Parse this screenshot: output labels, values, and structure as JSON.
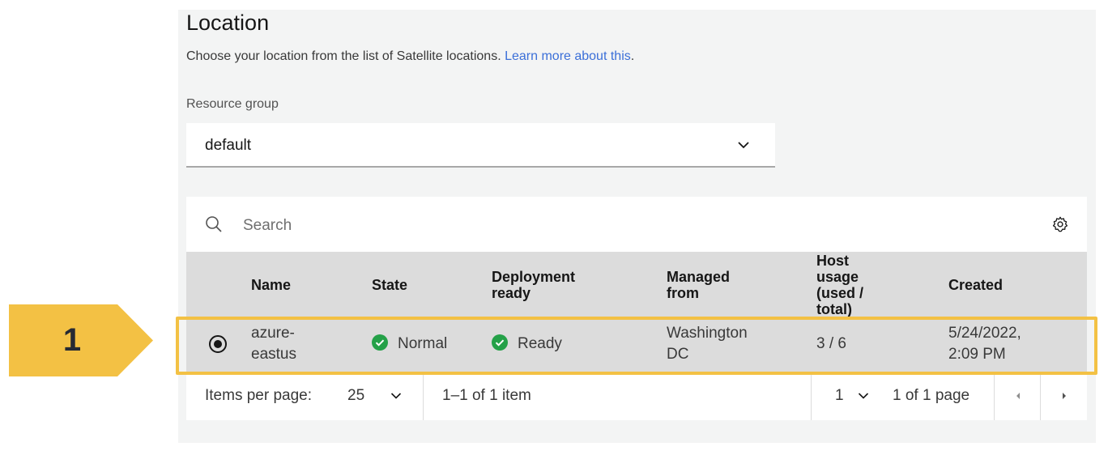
{
  "location": {
    "title": "Location",
    "description": "Choose your location from the list of Satellite locations.",
    "learn_more": "Learn more about this",
    "learn_more_suffix": "."
  },
  "resource_group": {
    "label": "Resource group",
    "selected": "default",
    "chevron_icon": "chevron-down-icon"
  },
  "table": {
    "search_placeholder": "Search",
    "settings_icon": "gear-icon",
    "columns": {
      "name": "Name",
      "state": "State",
      "deployment_line1": "Deployment",
      "deployment_line2": "ready",
      "managed_line1": "Managed",
      "managed_line2": "from",
      "host_line1": "Host",
      "host_line2": "usage",
      "host_line3": "(used /",
      "host_line4": "total)",
      "created": "Created"
    },
    "rows": [
      {
        "selected": true,
        "name_line1": "azure-",
        "name_line2": "eastus",
        "state": "Normal",
        "deployment_ready": "Ready",
        "managed_line1": "Washington",
        "managed_line2": "DC",
        "host_usage": "3 / 6",
        "created_line1": "5/24/2022,",
        "created_line2": "2:09 PM"
      }
    ],
    "status_color": "#24a148"
  },
  "pagination": {
    "items_per_page_label": "Items per page:",
    "items_per_page": "25",
    "range": "1–1 of 1 item",
    "page": "1",
    "page_total": "1 of 1 page"
  },
  "callout": {
    "number": "1",
    "color": "#f3c144"
  }
}
